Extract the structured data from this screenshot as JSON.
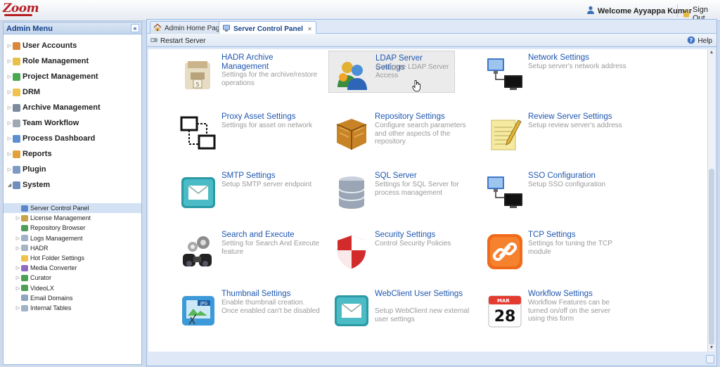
{
  "app": {
    "logo_text": "Zoom"
  },
  "header": {
    "welcome_text": "Welcome Ayyappa Kumar",
    "signout_label": "Sign Out"
  },
  "sidebar": {
    "title": "Admin Menu",
    "collapse_glyph": "«",
    "items": [
      {
        "label": "User Accounts",
        "icon": "users-icon",
        "expandable": true
      },
      {
        "label": "Role Management",
        "icon": "shield-role-icon",
        "expandable": true
      },
      {
        "label": "Project Management",
        "icon": "project-icon",
        "expandable": true
      },
      {
        "label": "DRM",
        "icon": "folder-icon",
        "expandable": true
      },
      {
        "label": "Archive Management",
        "icon": "archive-icon",
        "expandable": true
      },
      {
        "label": "Team Workflow",
        "icon": "workflow-icon",
        "expandable": true
      },
      {
        "label": "Process Dashboard",
        "icon": "dashboard-icon",
        "expandable": true
      },
      {
        "label": "Reports",
        "icon": "reports-icon",
        "expandable": true
      },
      {
        "label": "Plugin",
        "icon": "plugin-icon",
        "expandable": true
      },
      {
        "label": "System",
        "icon": "system-icon",
        "expandable": true,
        "expanded": true
      }
    ],
    "system_children": [
      {
        "label": "Server Control Panel",
        "icon": "server-panel-icon",
        "expandable": false,
        "selected": true
      },
      {
        "label": "License Management",
        "icon": "license-icon",
        "expandable": true
      },
      {
        "label": "Repository Browser",
        "icon": "repository-icon",
        "expandable": false
      },
      {
        "label": "Logs Management",
        "icon": "logs-icon",
        "expandable": true
      },
      {
        "label": "HADR",
        "icon": "hadr-icon",
        "expandable": true
      },
      {
        "label": "Hot Folder Settings",
        "icon": "hot-folder-icon",
        "expandable": false
      },
      {
        "label": "Media Converter",
        "icon": "media-converter-icon",
        "expandable": true
      },
      {
        "label": "Curator",
        "icon": "curator-icon",
        "expandable": true
      },
      {
        "label": "VideoLX",
        "icon": "videolx-icon",
        "expandable": true
      },
      {
        "label": "Email Domains",
        "icon": "email-domains-icon",
        "expandable": false
      },
      {
        "label": "Internal Tables",
        "icon": "internal-tables-icon",
        "expandable": true
      }
    ]
  },
  "tabs": [
    {
      "label": "Admin Home Page",
      "icon": "home-icon",
      "active": false
    },
    {
      "label": "Server Control Panel",
      "icon": "monitor-icon",
      "active": true,
      "close_glyph": "×"
    }
  ],
  "toolbar": {
    "restart_label": "Restart Server",
    "help_label": "Help"
  },
  "cards": [
    {
      "title": "HADR Archive Management",
      "desc": "Settings for the archive/restore operations",
      "icon": "archive-box-icon"
    },
    {
      "title": "LDAP Server Settings",
      "desc": "Configure LDAP Server Access",
      "icon": "ldap-users-icon",
      "hovered": true
    },
    {
      "title": "Network Settings",
      "desc": "Setup server's network address",
      "icon": "network-monitors-icon"
    },
    {
      "title": "Proxy Asset Settings",
      "desc": "Settings for asset on network",
      "icon": "proxy-icon"
    },
    {
      "title": "Repository Settings",
      "desc": "Configure search parameters and other aspects of the repository",
      "icon": "crate-icon"
    },
    {
      "title": "Review Server Settings",
      "desc": "Setup review server's address",
      "icon": "notepad-icon"
    },
    {
      "title": "SMTP Settings",
      "desc": "Setup SMTP server endpoint",
      "icon": "envelope-icon"
    },
    {
      "title": "SQL Server",
      "desc": "Settings for SQL Server for process management",
      "icon": "database-icon"
    },
    {
      "title": "SSO Configuration",
      "desc": "Setup SSO configuration",
      "icon": "network-monitors-icon"
    },
    {
      "title": "Search and Execute",
      "desc": "Setting for Search And Execute feature",
      "icon": "binoculars-gears-icon"
    },
    {
      "title": "Security Settings",
      "desc": "Control Security Policies",
      "icon": "security-shield-icon"
    },
    {
      "title": "TCP Settings",
      "desc": "Settings for tuning the TCP module",
      "icon": "link-icon"
    },
    {
      "title": "Thumbnail Settings",
      "desc": "Enable thumbnail creation. Once enabled can't be disabled",
      "icon": "thumbnail-icon"
    },
    {
      "title": "WebClient User Settings",
      "desc": "Setup WebClient new external user settings",
      "icon": "envelope-icon"
    },
    {
      "title": "Workflow Settings",
      "desc": "Workflow Features can be turned on/off on the server using this form",
      "icon": "calendar-icon"
    }
  ],
  "calendar": {
    "month": "MAR",
    "day": "28"
  },
  "thumbnail_tag": "JPG",
  "colors": {
    "link": "#1f57b0",
    "header_blue": "#15428b",
    "border": "#99bbe8",
    "logo_red": "#b71f23"
  }
}
